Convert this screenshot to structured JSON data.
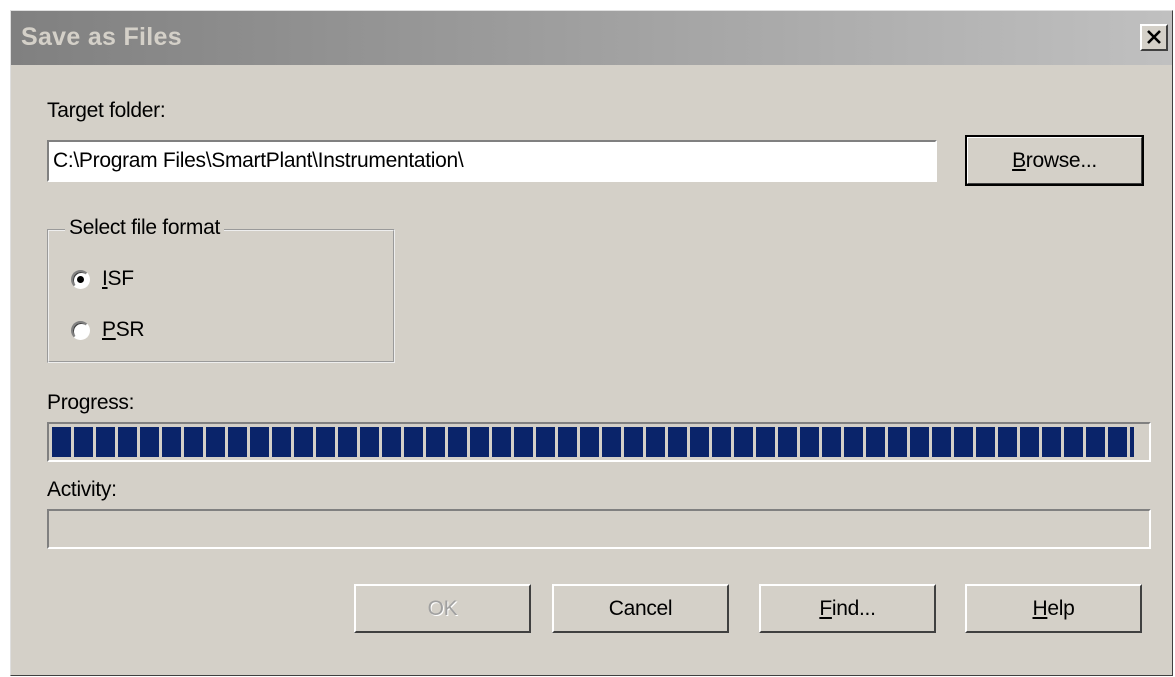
{
  "window": {
    "title": "Save as Files"
  },
  "target_folder": {
    "label": "Target folder:",
    "value": "C:\\Program Files\\SmartPlant\\Instrumentation\\",
    "browse_label_accel": "B",
    "browse_label_rest": "rowse..."
  },
  "file_format": {
    "legend": "Select file format",
    "options": [
      {
        "accel": "I",
        "rest": "SF",
        "selected": true
      },
      {
        "accel": "P",
        "rest": "SR",
        "selected": false
      }
    ]
  },
  "progress": {
    "label": "Progress:",
    "percent": 100
  },
  "activity": {
    "label": "Activity:",
    "text": ""
  },
  "buttons": {
    "ok": "OK",
    "cancel": "Cancel",
    "find_accel": "F",
    "find_rest": "ind...",
    "help_accel": "H",
    "help_rest": "elp"
  },
  "colors": {
    "face": "#d4d0c8",
    "progress_block": "#0a246a"
  },
  "icons": {
    "close": "close-icon"
  }
}
